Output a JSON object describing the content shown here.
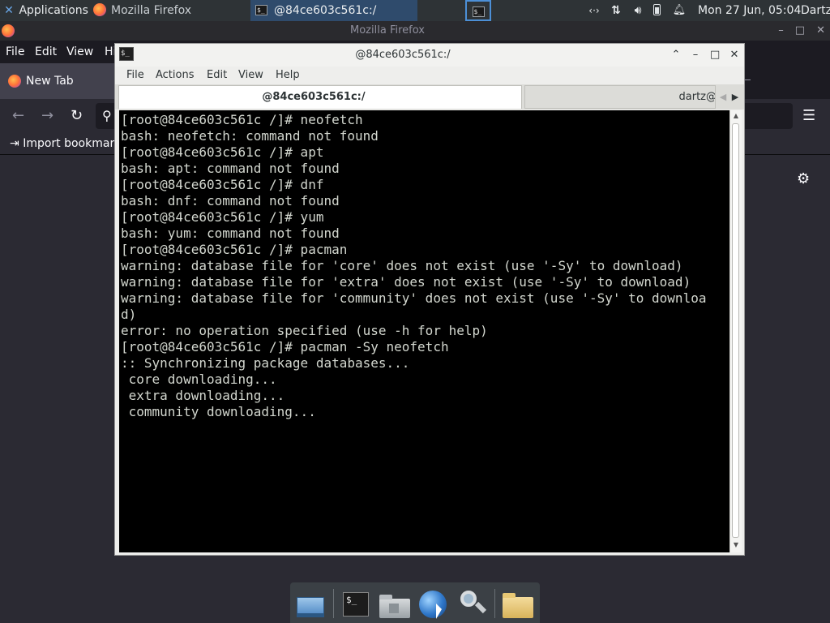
{
  "panel": {
    "applications_label": "Applications",
    "firefox_task_label": "Mozilla Firefox",
    "terminal_task_label": "@84ce603c561c:/",
    "clock": "Mon 27 Jun, 05:04",
    "user": "Dartz",
    "icons": [
      "xfce-icon",
      "firefox-icon",
      "terminal-icon",
      "network-icon",
      "transfer-icon",
      "volume-icon",
      "battery-icon",
      "notification-bell-icon"
    ]
  },
  "firefox": {
    "window_title": "Mozilla Firefox",
    "menu": [
      "File",
      "Edit",
      "View",
      "Hi"
    ],
    "tab_label": "New Tab",
    "import_bookmarks_label": "Import bookmar",
    "icons": [
      "back-icon",
      "forward-icon",
      "reload-icon",
      "search-icon",
      "hamburger-menu-icon",
      "settings-gear-icon"
    ]
  },
  "terminal": {
    "window_title": "@84ce603c561c:/",
    "menu": [
      "File",
      "Actions",
      "Edit",
      "View",
      "Help"
    ],
    "tabs": [
      {
        "label": "@84ce603c561c:/",
        "active": true
      },
      {
        "label": "dartz@",
        "active": false
      }
    ],
    "output": "[root@84ce603c561c /]# neofetch\nbash: neofetch: command not found\n[root@84ce603c561c /]# apt\nbash: apt: command not found\n[root@84ce603c561c /]# dnf\nbash: dnf: command not found\n[root@84ce603c561c /]# yum\nbash: yum: command not found\n[root@84ce603c561c /]# pacman\nwarning: database file for 'core' does not exist (use '-Sy' to download)\nwarning: database file for 'extra' does not exist (use '-Sy' to download)\nwarning: database file for 'community' does not exist (use '-Sy' to downloa\nd)\nerror: no operation specified (use -h for help)\n[root@84ce603c561c /]# pacman -Sy neofetch\n:: Synchronizing package databases...\n core downloading...\n extra downloading...\n community downloading...",
    "colors": {
      "background": "#000000",
      "foreground": "#d3d7cf"
    }
  },
  "dock": {
    "items": [
      "show-desktop-icon",
      "terminal-icon",
      "file-manager-icon",
      "web-browser-icon",
      "app-finder-icon",
      "folder-icon"
    ],
    "terminal_glyph": "$_"
  }
}
